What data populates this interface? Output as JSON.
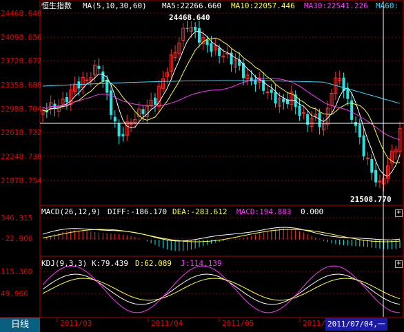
{
  "header": {
    "title": "恒生指数",
    "ma_label": "MA(5,10,30,60)",
    "ma5": "MA5:22266.660",
    "ma10": "MA10:22057.446",
    "ma30": "MA30:22541.226",
    "ma60": "MA60:"
  },
  "price_axis": [
    "24468.640",
    "24098.656",
    "23728.672",
    "23358.688",
    "22988.704",
    "22618.722",
    "22248.738",
    "21878.754"
  ],
  "price_annotations": {
    "high": "24468.640",
    "low": "21508.770"
  },
  "macd": {
    "label": "MACD(26,12,9)",
    "diff": "DIFF:-186.170",
    "dea": "DEA:-283.612",
    "macd": "MACD:194.883",
    "extra": "0.000",
    "axis": [
      "346.315",
      "-22.906"
    ]
  },
  "kdj": {
    "label": "KDJ(9,3,3)",
    "k": "K:79.439",
    "d": "D:62.089",
    "j": "J:114.139",
    "axis": [
      "115.360",
      "49.966"
    ]
  },
  "x_axis": [
    "2011/03",
    "2011/04",
    "2011/05",
    "2011/"
  ],
  "bottom": {
    "period_tab": "日线",
    "cursor_date": "2011/07/04,一"
  },
  "colors": {
    "up": "#ff3030",
    "down": "#22e6e6",
    "ma5": "#ffffff",
    "ma10": "#ffff33",
    "ma30": "#ff33ff",
    "ma60": "#33ddff",
    "grid": "#8b0000",
    "axis_text": "#e00000"
  },
  "icons": {
    "panel_expand": "plus-icon"
  }
}
